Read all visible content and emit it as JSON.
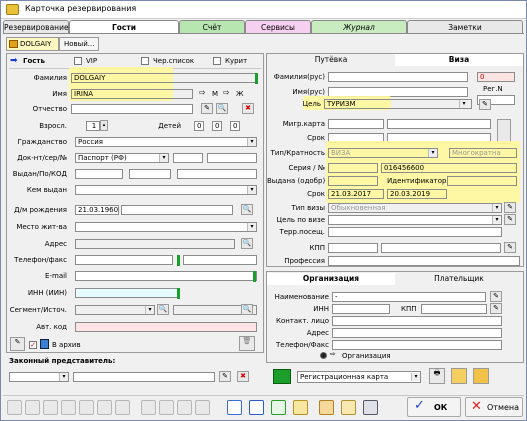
{
  "window": {
    "title": "Карточка резервирования"
  },
  "tabs": [
    "Резервирование",
    "Гости",
    "Счёт",
    "Сервисы",
    "Журнал",
    "Заметки"
  ],
  "guest_tabs": [
    "DOLGAIY",
    "Новый..."
  ],
  "guest": {
    "header": "Гость",
    "vip_label": "VIP",
    "blacklist_label": "Чер.список",
    "smoker_label": "Курит",
    "surname_label": "Фамилия",
    "surname": "DOLGAIY",
    "name_label": "Имя",
    "name": "IRINA",
    "patronymic_label": "Отчество",
    "male_label": "М",
    "female_label": "Ж",
    "adults_label": "Взросл.",
    "adults": "1",
    "children_label": "Детей",
    "children": [
      "0",
      "0",
      "0"
    ],
    "citizenship_label": "Гражданство",
    "citizenship": "Россия",
    "doc_label": "Док-нт/сер/№",
    "doc_type": "Паспорт (РФ)",
    "issued_code_label": "Выдан/По/КОД",
    "issued_by_label": "Кем выдан",
    "birth_label": "Д/м рождения",
    "birth": "21.03.1960",
    "residence_label": "Место жит-ва",
    "address_label": "Адрес",
    "phone_label": "Телефон/факс",
    "email_label": "E-mail",
    "inn_label": "ИНН (ИИН)",
    "segment_label": "Сегмент/Источ.",
    "autocode_label": "Авт. код",
    "archive_label": "В архив",
    "legal_rep_label": "Законный представитель:"
  },
  "right_tabs": [
    "Путёвка",
    "Виза"
  ],
  "visa": {
    "surname_rus_label": "Фамилия(рус)",
    "name_rus_label": "Имя(рус)",
    "purpose_label": "Цель",
    "purpose": "ТУРИЗМ",
    "zero": "0",
    "reg_no_label": "Рег.N",
    "migr_label": "Мигр.карта",
    "term_label": "Срок",
    "type_mult_label": "Тип/Кратность",
    "type": "ВИЗА",
    "mult": "Многократна",
    "serial_label": "Серия / №",
    "serial": "016456600",
    "issued_label": "Выдана (одобр)",
    "identifier_label": "Идентификатор",
    "term2_label": "Срок",
    "date_from": "21.03.2017",
    "date_to": "20.03.2019",
    "visa_type_label": "Тип визы",
    "visa_type": "Обыкновенная",
    "visa_purpose_label": "Цель по визе",
    "terr_label": "Терр.посещ.",
    "kpp_label": "КПП",
    "profession_label": "Профессия"
  },
  "org_tabs": [
    "Организация",
    "Плательщик"
  ],
  "org": {
    "name_label": "Наименование",
    "name_value": "-",
    "inn_label": "ИНН",
    "kpp_label": "КПП",
    "contact_label": "Контакт. лицо",
    "address_label": "Адрес",
    "phone_label": "Телефон/Факс",
    "org_radio_label": "Организация"
  },
  "registration": {
    "card": "Регистрационная карта"
  },
  "footer": {
    "ok_label": "ОК",
    "cancel_label": "Отмена"
  }
}
